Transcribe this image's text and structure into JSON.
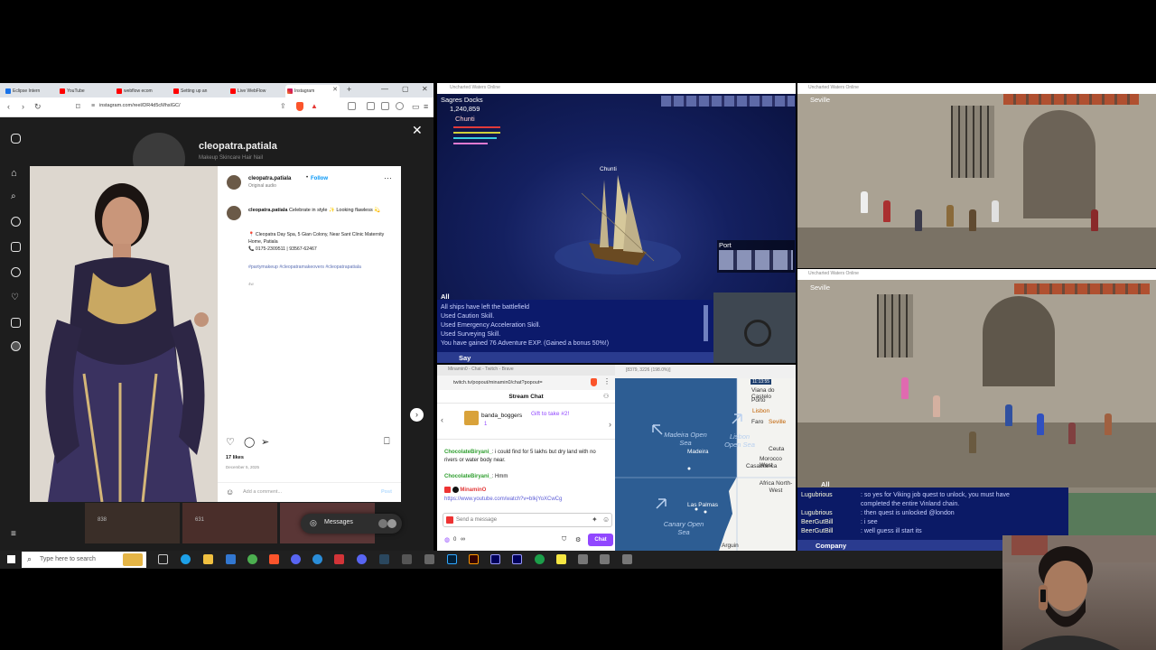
{
  "browser": {
    "tabs": [
      {
        "label": "Eclipse Intern"
      },
      {
        "label": "YouTube"
      },
      {
        "label": "webflow ecom"
      },
      {
        "label": "Setting up an"
      },
      {
        "label": "Live WebFlow"
      },
      {
        "label": "Instagram"
      }
    ],
    "url": "instagram.com/reel/DR4d5cMhslGC/"
  },
  "instagram": {
    "profile_name": "cleopatra.patiala",
    "profile_subtitle": "Makeup Skincare Hair Nail",
    "post": {
      "username": "cleopatra.patiala",
      "follow_label": "Follow",
      "audio": "Original audio",
      "caption_user": "cleopatra.patiala",
      "caption_text": "Celebrate in style ✨ Looking flawless 💫",
      "address": "📍 Cleopatra Day Spa, 5 Gian Colony, Near Sant Clinic Maternity Home, Patiala",
      "phone": "📞 0175-2309511 | 93567-62467",
      "hashtags": "#partymakeup #cleopatramakeovers #cleopatrapatiala",
      "age": "4w",
      "likes": "17 likes",
      "date": "December 5, 2025",
      "comment_placeholder": "Add a comment...",
      "post_label": "Post"
    },
    "thumb_views": [
      "838",
      "631"
    ],
    "messages_label": "Messages"
  },
  "game1": {
    "title": "Uncharted Waters Online",
    "location": "Sagres Docks",
    "gold": "1,240,859",
    "player": "Chunti",
    "ship_label": "Chunti",
    "port_label": "Port",
    "chat_channel": "All",
    "chat_lines": [
      "All ships have left the battlefield",
      "Used Caution Skill.",
      "Used Emergency Acceleration Skill.",
      "Used Surveying Skill.",
      "You have gained 76 Adventure EXP. (Gained a bonus 50%!)"
    ],
    "say_label": "Say"
  },
  "game2": {
    "title": "Uncharted Waters Online",
    "location": "Seville"
  },
  "game3": {
    "title": "Uncharted Waters Online",
    "location": "Seville",
    "chat_channel": "All",
    "chat_lines": [
      {
        "name": "Lugubrious",
        "text": ": so yes for Viking job quest to unlock, you must have"
      },
      {
        "name": "",
        "text": "completed the entire Vinland chain."
      },
      {
        "name": "Lugubrious",
        "text": ": then quest is unlocked @london"
      },
      {
        "name": "BeerGutBill",
        "text": ": i see"
      },
      {
        "name": "BeerGutBill",
        "text": ": well guess ill start its"
      }
    ],
    "company_label": "Company"
  },
  "twitch": {
    "title": "Minamin0 - Chat - Twitch - Brave",
    "url": "twitch.tv/popout/minamin0/chat?popout=",
    "header": "Stream Chat",
    "gift_user": "banda_boggers",
    "gift_count": "1",
    "gift_label": "Gift to take #2!",
    "messages": [
      {
        "user": "ChocolateBiryani_",
        "text": ": i could find for 5 lakhs but dry land with no rivers or water body near."
      },
      {
        "user": "ChocolateBiryani_",
        "text": ": Hmm"
      },
      {
        "user": "MinaminO",
        "text": ""
      },
      {
        "user": "",
        "text": "https://www.youtube.com/watch?v=bIkjYoXCwCg"
      }
    ],
    "input_placeholder": "Send a message",
    "points": "0",
    "chat_button": "Chat"
  },
  "map": {
    "title": "[8379, 3226 (198.0%)]",
    "coord_top": "11:13:55",
    "seas": [
      {
        "label": "Madeira Open Sea"
      },
      {
        "label": "Lisbon Open Sea"
      },
      {
        "label": "Canary Open Sea"
      }
    ],
    "cities": [
      "Viana do Castelo",
      "Porto",
      "Lisbon",
      "Faro",
      "Seville",
      "Ceuta",
      "Morocco West",
      "Casablanca",
      "Madeira",
      "Las Palmas",
      "Africa North-West",
      "Arguin"
    ]
  },
  "taskbar": {
    "search_placeholder": "Type here to search"
  }
}
